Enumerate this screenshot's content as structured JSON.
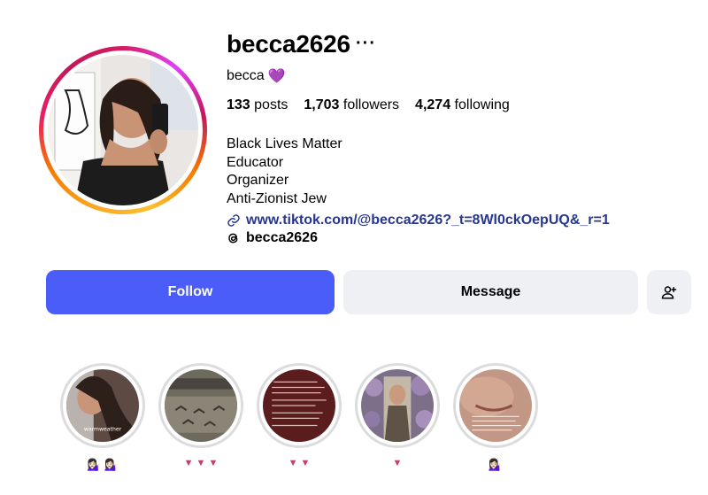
{
  "profile": {
    "username": "becca2626",
    "more_glyph": "···",
    "display_name": "becca",
    "display_emoji": "💜",
    "stats": {
      "posts_count": "133",
      "posts_label": "posts",
      "followers_count": "1,703",
      "followers_label": "followers",
      "following_count": "4,274",
      "following_label": "following"
    },
    "bio": [
      "Black Lives Matter",
      "Educator",
      "Organizer",
      "Anti-Zionist Jew"
    ],
    "link": "www.tiktok.com/@becca2626?_t=8Wl0ckOepUQ&_r=1",
    "threads_handle": "becca2626"
  },
  "buttons": {
    "follow": "Follow",
    "message": "Message"
  },
  "highlights": [
    {
      "label": "💁🏻‍♀️ 💁🏻‍♀️",
      "icon": "person-tipping-hand"
    },
    {
      "label": "▼ ▼ ▼",
      "icon": "red-triangle"
    },
    {
      "label": "▼ ▼",
      "icon": "red-triangle"
    },
    {
      "label": "▼",
      "icon": "red-triangle"
    },
    {
      "label": "💁🏻‍♀️",
      "icon": "person-tipping-hand"
    }
  ],
  "colors": {
    "follow_bg": "#4a5df9",
    "secondary_bg": "#eff0f3",
    "link": "#27378f",
    "triangle": "#c2406a"
  }
}
